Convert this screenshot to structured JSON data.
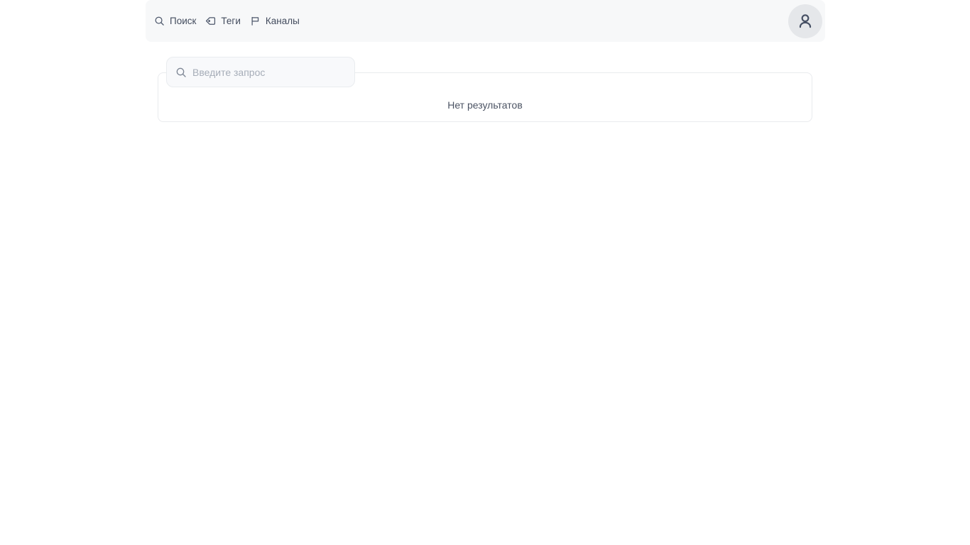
{
  "header": {
    "nav": [
      {
        "label": "Поиск",
        "icon": "search-icon"
      },
      {
        "label": "Теги",
        "icon": "tag-icon"
      },
      {
        "label": "Каналы",
        "icon": "flag-icon"
      }
    ],
    "avatar_icon": "person-icon"
  },
  "search": {
    "placeholder": "Введите запрос",
    "value": ""
  },
  "results": {
    "empty_message": "Нет результатов"
  },
  "colors": {
    "header_bg": "#f7f8f9",
    "avatar_bg": "#e5e7ea",
    "nav_text": "#434c5e",
    "card_border": "#e9ebee",
    "input_bg": "#f8f9fb",
    "placeholder_text": "#a6adb8",
    "empty_message_text": "#4b5363"
  }
}
